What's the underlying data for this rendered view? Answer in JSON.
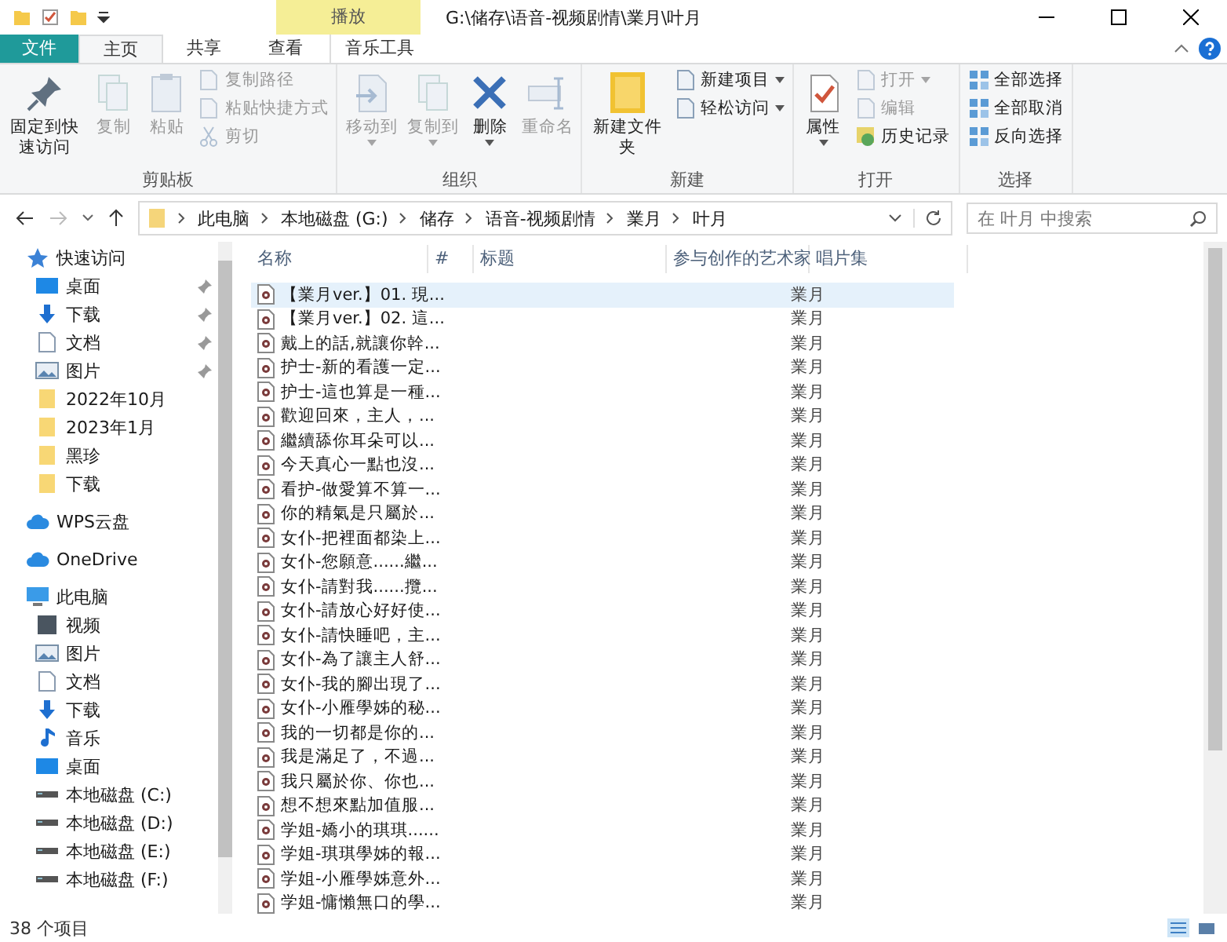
{
  "window": {
    "title": "G:\\储存\\语音-视频剧情\\業月\\叶月",
    "contextual_tab": "播放"
  },
  "tabs": [
    {
      "label": "文件",
      "kind": "file",
      "selected": false
    },
    {
      "label": "主页",
      "kind": "tab",
      "selected": true
    },
    {
      "label": "共享",
      "kind": "tab",
      "selected": false
    },
    {
      "label": "查看",
      "kind": "tab",
      "selected": false
    },
    {
      "label": "音乐工具",
      "kind": "context",
      "selected": false
    }
  ],
  "ribbon": [
    {
      "label": "剪贴板",
      "items": [
        {
          "label": "固定到快速访问",
          "kind": "large",
          "disabled": false,
          "dropdown": false
        },
        {
          "label": "复制",
          "kind": "large",
          "disabled": true,
          "dropdown": false
        },
        {
          "label": "粘贴",
          "kind": "large",
          "disabled": true,
          "dropdown": false
        },
        {
          "label": "复制路径",
          "kind": "small",
          "disabled": true,
          "dropdown": false
        },
        {
          "label": "粘贴快捷方式",
          "kind": "small",
          "disabled": true,
          "dropdown": false
        },
        {
          "label": "剪切",
          "kind": "small",
          "disabled": true,
          "dropdown": false
        }
      ]
    },
    {
      "label": "组织",
      "items": [
        {
          "label": "移动到",
          "kind": "large",
          "disabled": true,
          "dropdown": true
        },
        {
          "label": "复制到",
          "kind": "large",
          "disabled": true,
          "dropdown": true
        },
        {
          "label": "删除",
          "kind": "large",
          "disabled": false,
          "dropdown": true
        },
        {
          "label": "重命名",
          "kind": "large",
          "disabled": true,
          "dropdown": false
        }
      ]
    },
    {
      "label": "新建",
      "items": [
        {
          "label": "新建文件夹",
          "kind": "large",
          "disabled": false,
          "dropdown": false
        },
        {
          "label": "新建项目",
          "kind": "small",
          "disabled": false,
          "dropdown": true
        },
        {
          "label": "轻松访问",
          "kind": "small",
          "disabled": false,
          "dropdown": true
        }
      ]
    },
    {
      "label": "打开",
      "items": [
        {
          "label": "属性",
          "kind": "large",
          "disabled": false,
          "dropdown": true
        },
        {
          "label": "打开",
          "kind": "small",
          "disabled": true,
          "dropdown": true
        },
        {
          "label": "编辑",
          "kind": "small",
          "disabled": true,
          "dropdown": false
        },
        {
          "label": "历史记录",
          "kind": "small",
          "disabled": false,
          "dropdown": false
        }
      ]
    },
    {
      "label": "选择",
      "items": [
        {
          "label": "全部选择",
          "kind": "small",
          "disabled": false,
          "dropdown": false
        },
        {
          "label": "全部取消",
          "kind": "small",
          "disabled": false,
          "dropdown": false
        },
        {
          "label": "反向选择",
          "kind": "small",
          "disabled": false,
          "dropdown": false
        }
      ]
    }
  ],
  "breadcrumb": [
    "此电脑",
    "本地磁盘 (G:)",
    "储存",
    "语音-视频剧情",
    "業月",
    "叶月"
  ],
  "search": {
    "placeholder": "在 叶月 中搜索"
  },
  "columns": [
    "名称",
    "#",
    "标题",
    "参与创作的艺术家",
    "唱片集"
  ],
  "sidebar": [
    {
      "label": "快速访问",
      "kind": "star",
      "pinned": false
    },
    {
      "label": "桌面",
      "kind": "desktop",
      "pinned": true
    },
    {
      "label": "下载",
      "kind": "download",
      "pinned": true
    },
    {
      "label": "文档",
      "kind": "document",
      "pinned": true
    },
    {
      "label": "图片",
      "kind": "pictures",
      "pinned": true
    },
    {
      "label": "2022年10月",
      "kind": "folder",
      "pinned": false
    },
    {
      "label": "2023年1月",
      "kind": "folder",
      "pinned": false
    },
    {
      "label": "黑珍",
      "kind": "folder",
      "pinned": false
    },
    {
      "label": "下载",
      "kind": "folder",
      "pinned": false
    },
    {
      "label": "WPS云盘",
      "kind": "cloud",
      "pinned": false
    },
    {
      "label": "OneDrive",
      "kind": "cloud",
      "pinned": false
    },
    {
      "label": "此电脑",
      "kind": "pc",
      "pinned": false
    },
    {
      "label": "视频",
      "kind": "video",
      "pinned": false
    },
    {
      "label": "图片",
      "kind": "pictures",
      "pinned": false
    },
    {
      "label": "文档",
      "kind": "document",
      "pinned": false
    },
    {
      "label": "下载",
      "kind": "download",
      "pinned": false
    },
    {
      "label": "音乐",
      "kind": "music",
      "pinned": false
    },
    {
      "label": "桌面",
      "kind": "desktop",
      "pinned": false
    },
    {
      "label": "本地磁盘 (C:)",
      "kind": "drive",
      "pinned": false
    },
    {
      "label": "本地磁盘 (D:)",
      "kind": "drive",
      "pinned": false
    },
    {
      "label": "本地磁盘 (E:)",
      "kind": "drive",
      "pinned": false
    },
    {
      "label": "本地磁盘 (F:)",
      "kind": "drive",
      "pinned": false
    }
  ],
  "files": [
    {
      "name": "【業月ver.】01. 現...",
      "album": "業月",
      "selected": true
    },
    {
      "name": "【業月ver.】02. 這...",
      "album": "業月",
      "selected": false
    },
    {
      "name": "戴上的話,就讓你幹...",
      "album": "業月",
      "selected": false
    },
    {
      "name": "护士-新的看護一定...",
      "album": "業月",
      "selected": false
    },
    {
      "name": "护士-這也算是一種...",
      "album": "業月",
      "selected": false
    },
    {
      "name": "歡迎回來，主人，...",
      "album": "業月",
      "selected": false
    },
    {
      "name": "繼續舔你耳朵可以...",
      "album": "業月",
      "selected": false
    },
    {
      "name": "今天真心一點也沒...",
      "album": "業月",
      "selected": false
    },
    {
      "name": "看护-做愛算不算一...",
      "album": "業月",
      "selected": false
    },
    {
      "name": "你的精氣是只屬於...",
      "album": "業月",
      "selected": false
    },
    {
      "name": "女仆-把裡面都染上...",
      "album": "業月",
      "selected": false
    },
    {
      "name": "女仆-您願意......繼...",
      "album": "業月",
      "selected": false
    },
    {
      "name": "女仆-請對我......攬...",
      "album": "業月",
      "selected": false
    },
    {
      "name": "女仆-請放心好好使...",
      "album": "業月",
      "selected": false
    },
    {
      "name": "女仆-請快睡吧，主...",
      "album": "業月",
      "selected": false
    },
    {
      "name": "女仆-為了讓主人舒...",
      "album": "業月",
      "selected": false
    },
    {
      "name": "女仆-我的腳出現了...",
      "album": "業月",
      "selected": false
    },
    {
      "name": "女仆-小雁學姊的秘...",
      "album": "業月",
      "selected": false
    },
    {
      "name": "我的一切都是你的...",
      "album": "業月",
      "selected": false
    },
    {
      "name": "我是滿足了，不過...",
      "album": "業月",
      "selected": false
    },
    {
      "name": "我只屬於你、你也...",
      "album": "業月",
      "selected": false
    },
    {
      "name": "想不想來點加值服...",
      "album": "業月",
      "selected": false
    },
    {
      "name": "学姐-嬌小的琪琪......",
      "album": "業月",
      "selected": false
    },
    {
      "name": "学姐-琪琪學姊的報...",
      "album": "業月",
      "selected": false
    },
    {
      "name": "学姐-小雁學姊意外...",
      "album": "業月",
      "selected": false
    },
    {
      "name": "学姐-慵懶無口的學...",
      "album": "業月",
      "selected": false
    }
  ],
  "status_bar": "38 个项目"
}
